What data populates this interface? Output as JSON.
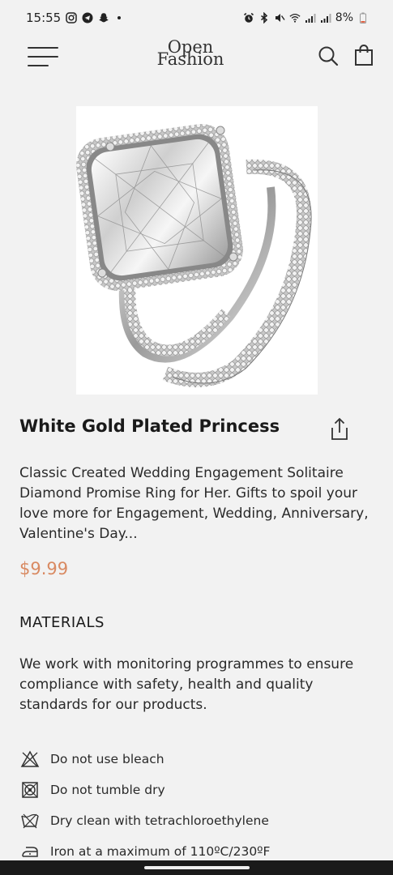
{
  "status_bar": {
    "time": "15:55",
    "battery": "8%"
  },
  "header": {
    "logo_line1": "Open",
    "logo_line2": "Fashion"
  },
  "product": {
    "title": "White Gold Plated Princess",
    "description": "Classic Created Wedding Engagement Solitaire Diamond Promise Ring for Her. Gifts to spoil your love more for Engagement, Wedding, Anniversary, Valentine's Day...",
    "price": "$9.99"
  },
  "materials": {
    "heading": "MATERIALS",
    "text": "We work with monitoring programmes to ensure compliance with safety, health and quality standards for our products."
  },
  "care_items": [
    {
      "icon": "no-bleach-icon",
      "label": "Do not use bleach"
    },
    {
      "icon": "no-tumble-dry-icon",
      "label": "Do not tumble dry"
    },
    {
      "icon": "dry-clean-icon",
      "label": "Dry clean with tetrachloroethylene"
    },
    {
      "icon": "iron-icon",
      "label": "Iron at a maximum of 110ºC/230ºF"
    }
  ],
  "colors": {
    "background": "#f2f2f2",
    "price": "#d98a62",
    "text": "#1f1f1f"
  }
}
